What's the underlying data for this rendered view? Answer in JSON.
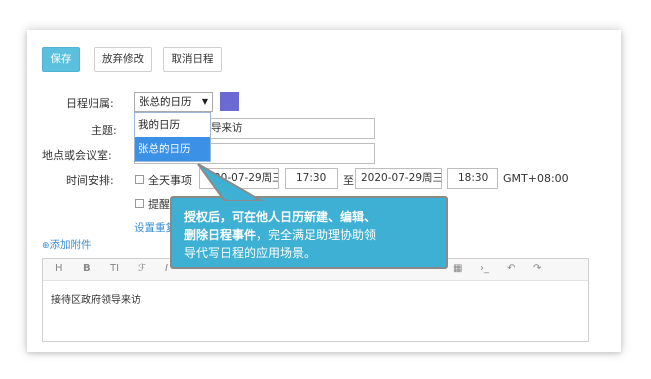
{
  "toolbar": {
    "save_label": "保存",
    "discard_label": "放弃修改",
    "cancel_label": "取消日程"
  },
  "form": {
    "calendar_label": "日程归属:",
    "calendar_selected": "张总的日历",
    "calendar_options": [
      "我的日历",
      "张总的日历"
    ],
    "calendar_color": "#6a6ad2",
    "subject_label": "主题:",
    "subject_value": "接待区政府领导来访",
    "subject_visible_suffix": "导来访",
    "location_label": "地点或会议室:",
    "time_label": "时间安排:",
    "allday_label": "全天事项",
    "start_date": "2020-07-29周三",
    "start_date_visible": "20-07-29周三",
    "start_time": "17:30",
    "to_label": "至",
    "end_date": "2020-07-29周三",
    "end_time": "18:30",
    "timezone": "GMT+08:00",
    "remind_label": "提醒",
    "repeat_link": "设置重复"
  },
  "attachment_link": "添加附件",
  "editor": {
    "tools": [
      "H",
      "B",
      "TI",
      "ℱ",
      "I"
    ],
    "body_text": "接待区政府领导来访"
  },
  "tooltip": {
    "line1_bold": "授权后，可在他人日历新建、编辑、",
    "line2_bold": "删除日程事件",
    "line2_rest": "，完全满足助理协助领",
    "line3": "导代写日程的应用场景。"
  }
}
